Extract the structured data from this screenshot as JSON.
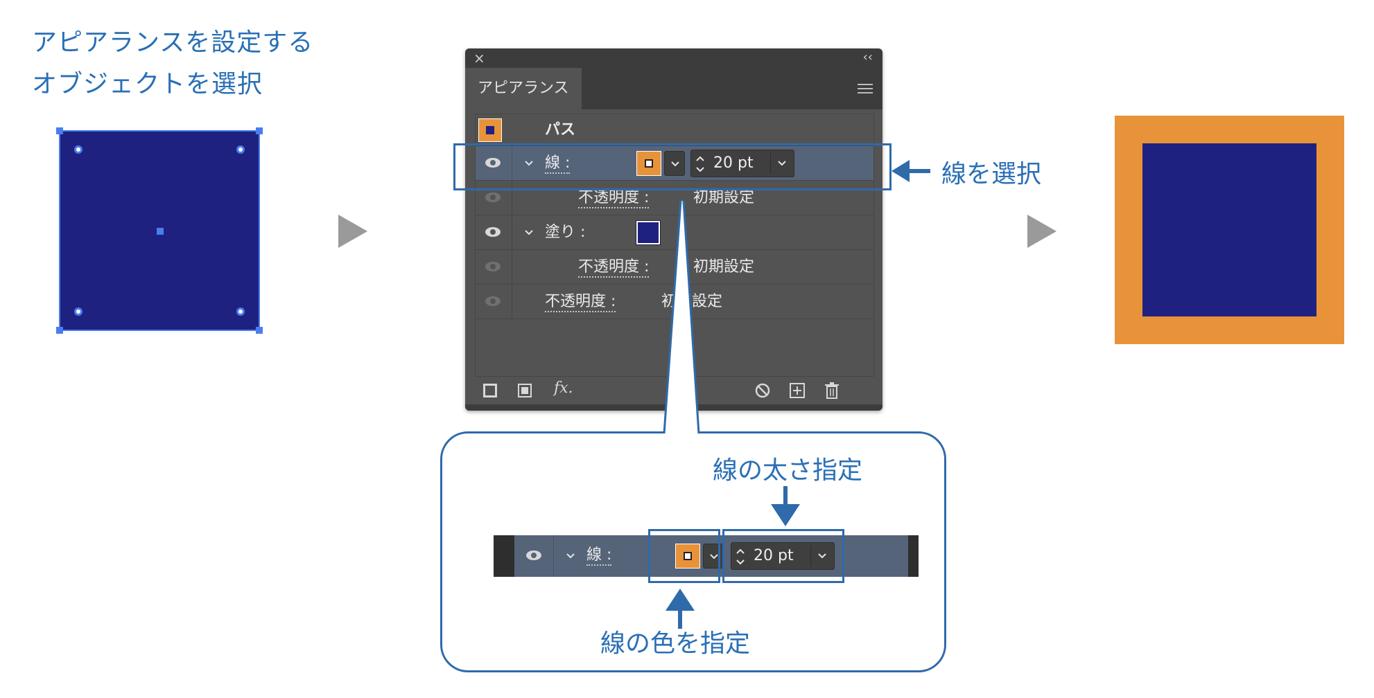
{
  "step1": {
    "line1": "アピアランスを設定する",
    "line2": "オブジェクトを選択"
  },
  "panel": {
    "close_glyph": "×",
    "collapse_glyph": "‹‹",
    "tab_label": "アピアランス",
    "menu_icon": "hamburger-menu-icon",
    "title_row": {
      "label": "パス"
    },
    "stroke_row": {
      "label": "線 :",
      "weight_value": "20 pt"
    },
    "stroke_opacity_row": {
      "label": "不透明度 :",
      "value": "初期設定"
    },
    "fill_row": {
      "label": "塗り :"
    },
    "fill_opacity_row": {
      "label": "不透明度 :",
      "value": "初期設定"
    },
    "object_opacity_row": {
      "label": "不透明度 :",
      "value": "初期設定"
    },
    "footer": {
      "fx_label": "fx."
    }
  },
  "annotations": {
    "select_stroke": "線を選択",
    "weight": "線の太さ指定",
    "color": "線の色を指定"
  },
  "zoom_strip": {
    "label": "線 :",
    "weight_value": "20 pt"
  },
  "colors": {
    "fill": "#1f2181",
    "stroke": "#e8923a",
    "accent": "#2f6aaa",
    "selection": "#4a7df0"
  }
}
